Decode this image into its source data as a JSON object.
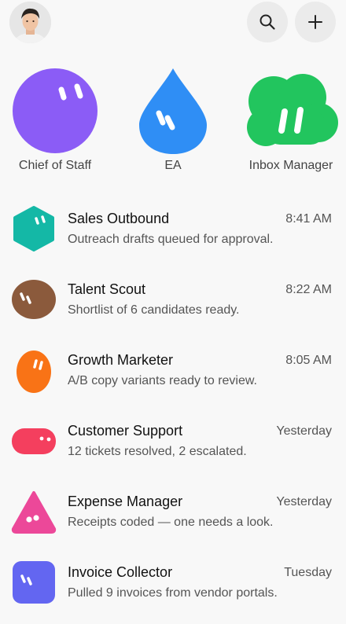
{
  "header": {
    "avatar_icon": "user-avatar",
    "search_icon": "search-icon",
    "add_icon": "plus-icon"
  },
  "featured": [
    {
      "label": "Chief of Staff",
      "color": "#8b5cf6",
      "icon": "purple-circle-blob"
    },
    {
      "label": "EA",
      "color": "#2f8ef5",
      "icon": "blue-drop-blob"
    },
    {
      "label": "Inbox Manager",
      "color": "#22c55e",
      "icon": "green-cloud-blob"
    }
  ],
  "agents": [
    {
      "name": "Sales Outbound",
      "time": "8:41 AM",
      "preview": "Outreach drafts queued for approval.",
      "color": "#14b8a6",
      "icon": "teal-hexagon-blob"
    },
    {
      "name": "Talent Scout",
      "time": "8:22 AM",
      "preview": "Shortlist of 6 candidates ready.",
      "color": "#8b5a3c",
      "icon": "brown-oval-blob"
    },
    {
      "name": "Growth Marketer",
      "time": "8:05 AM",
      "preview": "A/B copy variants ready to review.",
      "color": "#f97316",
      "icon": "orange-egg-blob"
    },
    {
      "name": "Customer Support",
      "time": "Yesterday",
      "preview": "12 tickets resolved, 2 escalated.",
      "color": "#f43f5e",
      "icon": "red-pill-blob"
    },
    {
      "name": "Expense Manager",
      "time": "Yesterday",
      "preview": "Receipts coded — one needs a look.",
      "color": "#ec4899",
      "icon": "pink-triangle-blob"
    },
    {
      "name": "Invoice Collector",
      "time": "Tuesday",
      "preview": "Pulled 9 invoices from vendor portals.",
      "color": "#6366f1",
      "icon": "indigo-square-blob"
    }
  ]
}
